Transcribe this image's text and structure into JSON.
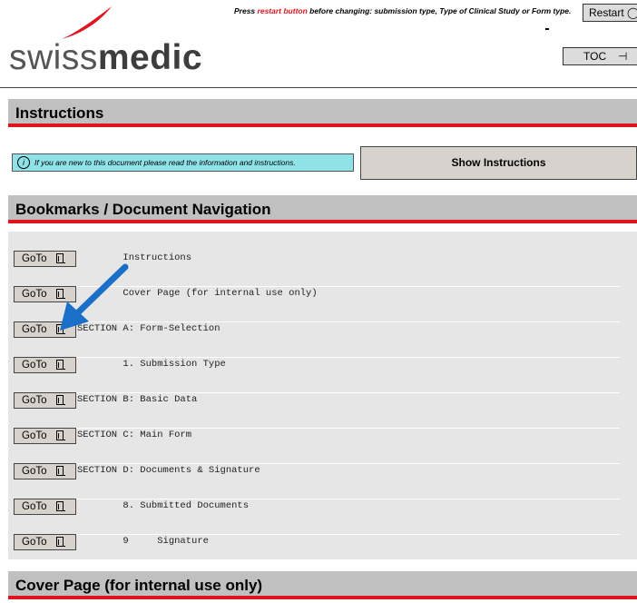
{
  "header": {
    "notice_before": "Press ",
    "notice_red": "restart button",
    "notice_after": " before changing: submission type, Type of Clinical Study or Form type.",
    "restart_label": "Restart ◯",
    "toc_label": "TOC",
    "toc_icon": "tree-icon",
    "logo_light": "swiss",
    "logo_bold": "medic"
  },
  "colors": {
    "accent_red": "#e0141e",
    "info_cyan": "#8fe3e8",
    "header_gray": "#c0c0c0"
  },
  "instructions": {
    "title": "Instructions",
    "info_text": "If you are new to this document please read the information and instructions.",
    "show_button": "Show Instructions"
  },
  "bookmarks": {
    "title": "Bookmarks / Document Navigation",
    "goto_label": "GoTo",
    "items": [
      {
        "label": "        Instructions"
      },
      {
        "label": "        Cover Page (for internal use only)"
      },
      {
        "label": "SECTION A: Form-Selection"
      },
      {
        "label": "        1. Submission Type"
      },
      {
        "label": "SECTION B: Basic Data"
      },
      {
        "label": "SECTION C: Main Form"
      },
      {
        "label": "SECTION D: Documents & Signature"
      },
      {
        "label": "        8. Submitted Documents"
      },
      {
        "label": "        9     Signature"
      }
    ]
  },
  "cover": {
    "title": "Cover Page (for internal use only)"
  }
}
